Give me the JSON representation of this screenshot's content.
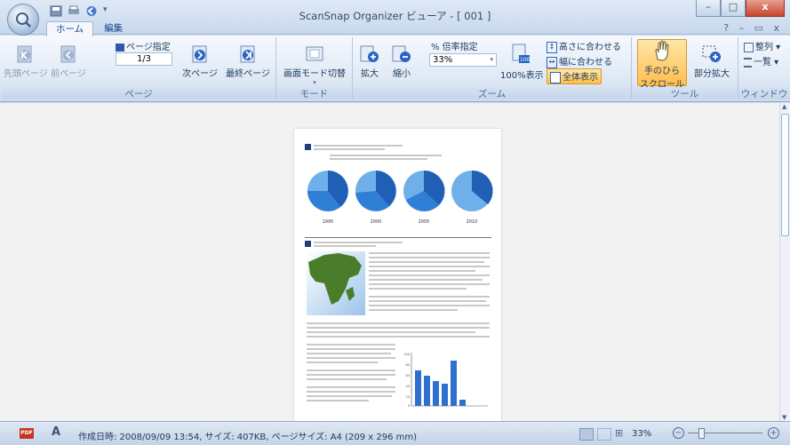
{
  "window": {
    "title": "ScanSnap Organizer ビューア - [ 001 ]",
    "minimize": "–",
    "maximize": "□",
    "close": "x"
  },
  "tabs": [
    {
      "label": "ホーム"
    },
    {
      "label": "編集"
    }
  ],
  "help": "? – ▭ x",
  "ribbon": {
    "page_group": {
      "label": "ページ",
      "first": "先頭ページ",
      "prev": "前ページ",
      "goto": "ページ指定",
      "page_value": "1/3",
      "next": "次ページ",
      "last": "最終ページ"
    },
    "mode_group": {
      "label": "モード",
      "switch": "画面モード切替"
    },
    "zoom_group": {
      "label": "ズーム",
      "zoom_in": "拡大",
      "zoom_out": "縮小",
      "percent_label": "% 倍率指定",
      "percent_value": "33%",
      "hundred": "100%表示",
      "fit_height": "高さに合わせる",
      "fit_width": "幅に合わせる",
      "fit_all": "全体表示"
    },
    "tool_group": {
      "label": "ツール",
      "hand_line1": "手のひら",
      "hand_line2": "スクロール",
      "partial": "部分拡大"
    },
    "window_group": {
      "label": "ウィンドウ",
      "arrange": "整列 ▾",
      "list": "一覧 ▾"
    }
  },
  "document": {
    "years": [
      "1995",
      "2000",
      "2005",
      "2010"
    ],
    "bar_axis": [
      "100",
      "80",
      "60",
      "40",
      "20",
      "0"
    ]
  },
  "status": {
    "pdf": "PDF",
    "info": "作成日時: 2008/09/09 13:54, サイズ: 407KB, ページサイズ: A4 (209 x 296 mm)",
    "zoom": "33%"
  }
}
